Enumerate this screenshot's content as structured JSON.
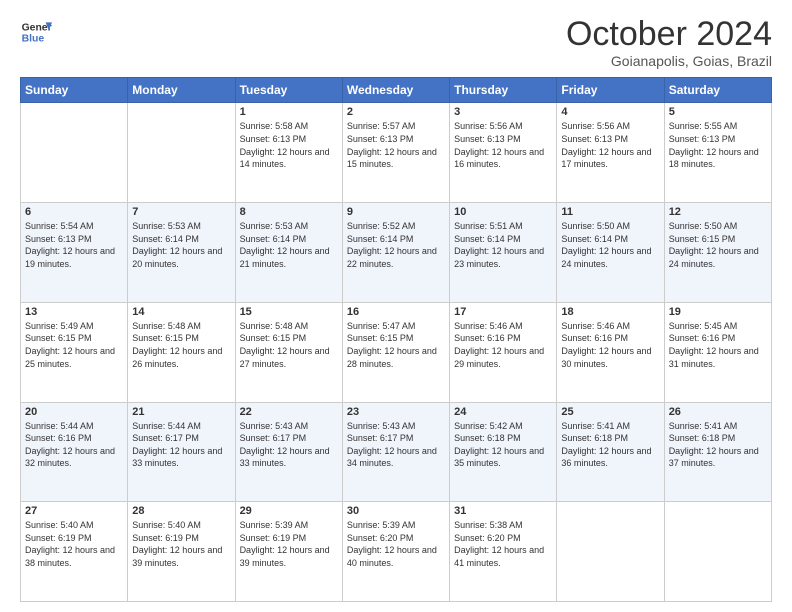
{
  "logo": {
    "line1": "General",
    "line2": "Blue"
  },
  "header": {
    "month": "October 2024",
    "location": "Goianapolis, Goias, Brazil"
  },
  "days_of_week": [
    "Sunday",
    "Monday",
    "Tuesday",
    "Wednesday",
    "Thursday",
    "Friday",
    "Saturday"
  ],
  "weeks": [
    [
      {
        "day": "",
        "sunrise": "",
        "sunset": "",
        "daylight": ""
      },
      {
        "day": "",
        "sunrise": "",
        "sunset": "",
        "daylight": ""
      },
      {
        "day": "1",
        "sunrise": "Sunrise: 5:58 AM",
        "sunset": "Sunset: 6:13 PM",
        "daylight": "Daylight: 12 hours and 14 minutes."
      },
      {
        "day": "2",
        "sunrise": "Sunrise: 5:57 AM",
        "sunset": "Sunset: 6:13 PM",
        "daylight": "Daylight: 12 hours and 15 minutes."
      },
      {
        "day": "3",
        "sunrise": "Sunrise: 5:56 AM",
        "sunset": "Sunset: 6:13 PM",
        "daylight": "Daylight: 12 hours and 16 minutes."
      },
      {
        "day": "4",
        "sunrise": "Sunrise: 5:56 AM",
        "sunset": "Sunset: 6:13 PM",
        "daylight": "Daylight: 12 hours and 17 minutes."
      },
      {
        "day": "5",
        "sunrise": "Sunrise: 5:55 AM",
        "sunset": "Sunset: 6:13 PM",
        "daylight": "Daylight: 12 hours and 18 minutes."
      }
    ],
    [
      {
        "day": "6",
        "sunrise": "Sunrise: 5:54 AM",
        "sunset": "Sunset: 6:13 PM",
        "daylight": "Daylight: 12 hours and 19 minutes."
      },
      {
        "day": "7",
        "sunrise": "Sunrise: 5:53 AM",
        "sunset": "Sunset: 6:14 PM",
        "daylight": "Daylight: 12 hours and 20 minutes."
      },
      {
        "day": "8",
        "sunrise": "Sunrise: 5:53 AM",
        "sunset": "Sunset: 6:14 PM",
        "daylight": "Daylight: 12 hours and 21 minutes."
      },
      {
        "day": "9",
        "sunrise": "Sunrise: 5:52 AM",
        "sunset": "Sunset: 6:14 PM",
        "daylight": "Daylight: 12 hours and 22 minutes."
      },
      {
        "day": "10",
        "sunrise": "Sunrise: 5:51 AM",
        "sunset": "Sunset: 6:14 PM",
        "daylight": "Daylight: 12 hours and 23 minutes."
      },
      {
        "day": "11",
        "sunrise": "Sunrise: 5:50 AM",
        "sunset": "Sunset: 6:14 PM",
        "daylight": "Daylight: 12 hours and 24 minutes."
      },
      {
        "day": "12",
        "sunrise": "Sunrise: 5:50 AM",
        "sunset": "Sunset: 6:15 PM",
        "daylight": "Daylight: 12 hours and 24 minutes."
      }
    ],
    [
      {
        "day": "13",
        "sunrise": "Sunrise: 5:49 AM",
        "sunset": "Sunset: 6:15 PM",
        "daylight": "Daylight: 12 hours and 25 minutes."
      },
      {
        "day": "14",
        "sunrise": "Sunrise: 5:48 AM",
        "sunset": "Sunset: 6:15 PM",
        "daylight": "Daylight: 12 hours and 26 minutes."
      },
      {
        "day": "15",
        "sunrise": "Sunrise: 5:48 AM",
        "sunset": "Sunset: 6:15 PM",
        "daylight": "Daylight: 12 hours and 27 minutes."
      },
      {
        "day": "16",
        "sunrise": "Sunrise: 5:47 AM",
        "sunset": "Sunset: 6:15 PM",
        "daylight": "Daylight: 12 hours and 28 minutes."
      },
      {
        "day": "17",
        "sunrise": "Sunrise: 5:46 AM",
        "sunset": "Sunset: 6:16 PM",
        "daylight": "Daylight: 12 hours and 29 minutes."
      },
      {
        "day": "18",
        "sunrise": "Sunrise: 5:46 AM",
        "sunset": "Sunset: 6:16 PM",
        "daylight": "Daylight: 12 hours and 30 minutes."
      },
      {
        "day": "19",
        "sunrise": "Sunrise: 5:45 AM",
        "sunset": "Sunset: 6:16 PM",
        "daylight": "Daylight: 12 hours and 31 minutes."
      }
    ],
    [
      {
        "day": "20",
        "sunrise": "Sunrise: 5:44 AM",
        "sunset": "Sunset: 6:16 PM",
        "daylight": "Daylight: 12 hours and 32 minutes."
      },
      {
        "day": "21",
        "sunrise": "Sunrise: 5:44 AM",
        "sunset": "Sunset: 6:17 PM",
        "daylight": "Daylight: 12 hours and 33 minutes."
      },
      {
        "day": "22",
        "sunrise": "Sunrise: 5:43 AM",
        "sunset": "Sunset: 6:17 PM",
        "daylight": "Daylight: 12 hours and 33 minutes."
      },
      {
        "day": "23",
        "sunrise": "Sunrise: 5:43 AM",
        "sunset": "Sunset: 6:17 PM",
        "daylight": "Daylight: 12 hours and 34 minutes."
      },
      {
        "day": "24",
        "sunrise": "Sunrise: 5:42 AM",
        "sunset": "Sunset: 6:18 PM",
        "daylight": "Daylight: 12 hours and 35 minutes."
      },
      {
        "day": "25",
        "sunrise": "Sunrise: 5:41 AM",
        "sunset": "Sunset: 6:18 PM",
        "daylight": "Daylight: 12 hours and 36 minutes."
      },
      {
        "day": "26",
        "sunrise": "Sunrise: 5:41 AM",
        "sunset": "Sunset: 6:18 PM",
        "daylight": "Daylight: 12 hours and 37 minutes."
      }
    ],
    [
      {
        "day": "27",
        "sunrise": "Sunrise: 5:40 AM",
        "sunset": "Sunset: 6:19 PM",
        "daylight": "Daylight: 12 hours and 38 minutes."
      },
      {
        "day": "28",
        "sunrise": "Sunrise: 5:40 AM",
        "sunset": "Sunset: 6:19 PM",
        "daylight": "Daylight: 12 hours and 39 minutes."
      },
      {
        "day": "29",
        "sunrise": "Sunrise: 5:39 AM",
        "sunset": "Sunset: 6:19 PM",
        "daylight": "Daylight: 12 hours and 39 minutes."
      },
      {
        "day": "30",
        "sunrise": "Sunrise: 5:39 AM",
        "sunset": "Sunset: 6:20 PM",
        "daylight": "Daylight: 12 hours and 40 minutes."
      },
      {
        "day": "31",
        "sunrise": "Sunrise: 5:38 AM",
        "sunset": "Sunset: 6:20 PM",
        "daylight": "Daylight: 12 hours and 41 minutes."
      },
      {
        "day": "",
        "sunrise": "",
        "sunset": "",
        "daylight": ""
      },
      {
        "day": "",
        "sunrise": "",
        "sunset": "",
        "daylight": ""
      }
    ]
  ]
}
